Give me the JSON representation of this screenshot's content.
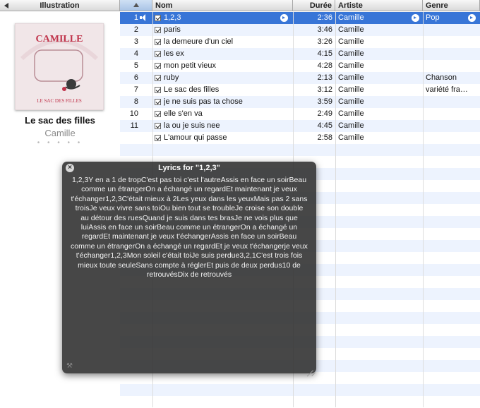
{
  "left_pane": {
    "header": "Illustration",
    "album_art_text_top": "CAMILLE",
    "album_art_text_bottom": "LE SAC DES FILLES",
    "album_title": "Le sac des filles",
    "album_artist": "Camille",
    "rating_dots": "• • • • •"
  },
  "table": {
    "columns": {
      "nom": "Nom",
      "duree": "Durée",
      "artiste": "Artiste",
      "genre": "Genre"
    },
    "rows": [
      {
        "num": "1",
        "name": "1,2,3",
        "duration": "2:36",
        "artist": "Camille",
        "genre": "Pop"
      },
      {
        "num": "2",
        "name": "paris",
        "duration": "3:46",
        "artist": "Camille",
        "genre": ""
      },
      {
        "num": "3",
        "name": "la demeure d'un ciel",
        "duration": "3:26",
        "artist": "Camille",
        "genre": ""
      },
      {
        "num": "4",
        "name": "les ex",
        "duration": "4:15",
        "artist": "Camille",
        "genre": ""
      },
      {
        "num": "5",
        "name": "mon petit vieux",
        "duration": "4:28",
        "artist": "Camille",
        "genre": ""
      },
      {
        "num": "6",
        "name": "ruby",
        "duration": "2:13",
        "artist": "Camille",
        "genre": "Chanson"
      },
      {
        "num": "7",
        "name": "Le sac des filles",
        "duration": "3:12",
        "artist": "Camille",
        "genre": "variété française"
      },
      {
        "num": "8",
        "name": "je ne suis pas ta chose",
        "duration": "3:59",
        "artist": "Camille",
        "genre": ""
      },
      {
        "num": "10",
        "name": "elle s'en va",
        "duration": "2:49",
        "artist": "Camille",
        "genre": ""
      },
      {
        "num": "11",
        "name": "la ou je suis nee",
        "duration": "4:45",
        "artist": "Camille",
        "genre": ""
      },
      {
        "num": "",
        "name": "L'amour qui passe",
        "duration": "2:58",
        "artist": "Camille",
        "genre": ""
      }
    ]
  },
  "lyrics_hud": {
    "title": "Lyrics for \"1,2,3\"",
    "close_label": "×",
    "tools_label": "⚒",
    "lyrics": "1,2,3Y en a 1 de tropC'est pas toi c'est l'autreAssis en face un soirBeau comme un étrangerOn a échangé un regardEt maintenant je veux t'échanger1,2,3C'était mieux à 2Les yeux dans les yeuxMais pas 2 sans troisJe veux vivre sans toiOu bien tout se troubleJe croise son double au détour des ruesQuand je suis dans tes brasJe ne vois plus que luiAssis en face un soirBeau comme un étrangerOn a échangé un regardEt maintenant je veux t'échangerAssis en face un soirBeau comme un étrangerOn a échangé un regardEt je veux t'échangerje veux t'échanger1,2,3Mon soleil c'était toiJe suis perdue3,2,1C'est trois fois mieux toute seuleSans compte à réglerEt puis de deux perdus10 de retrouvésDix de retrouvés"
  }
}
